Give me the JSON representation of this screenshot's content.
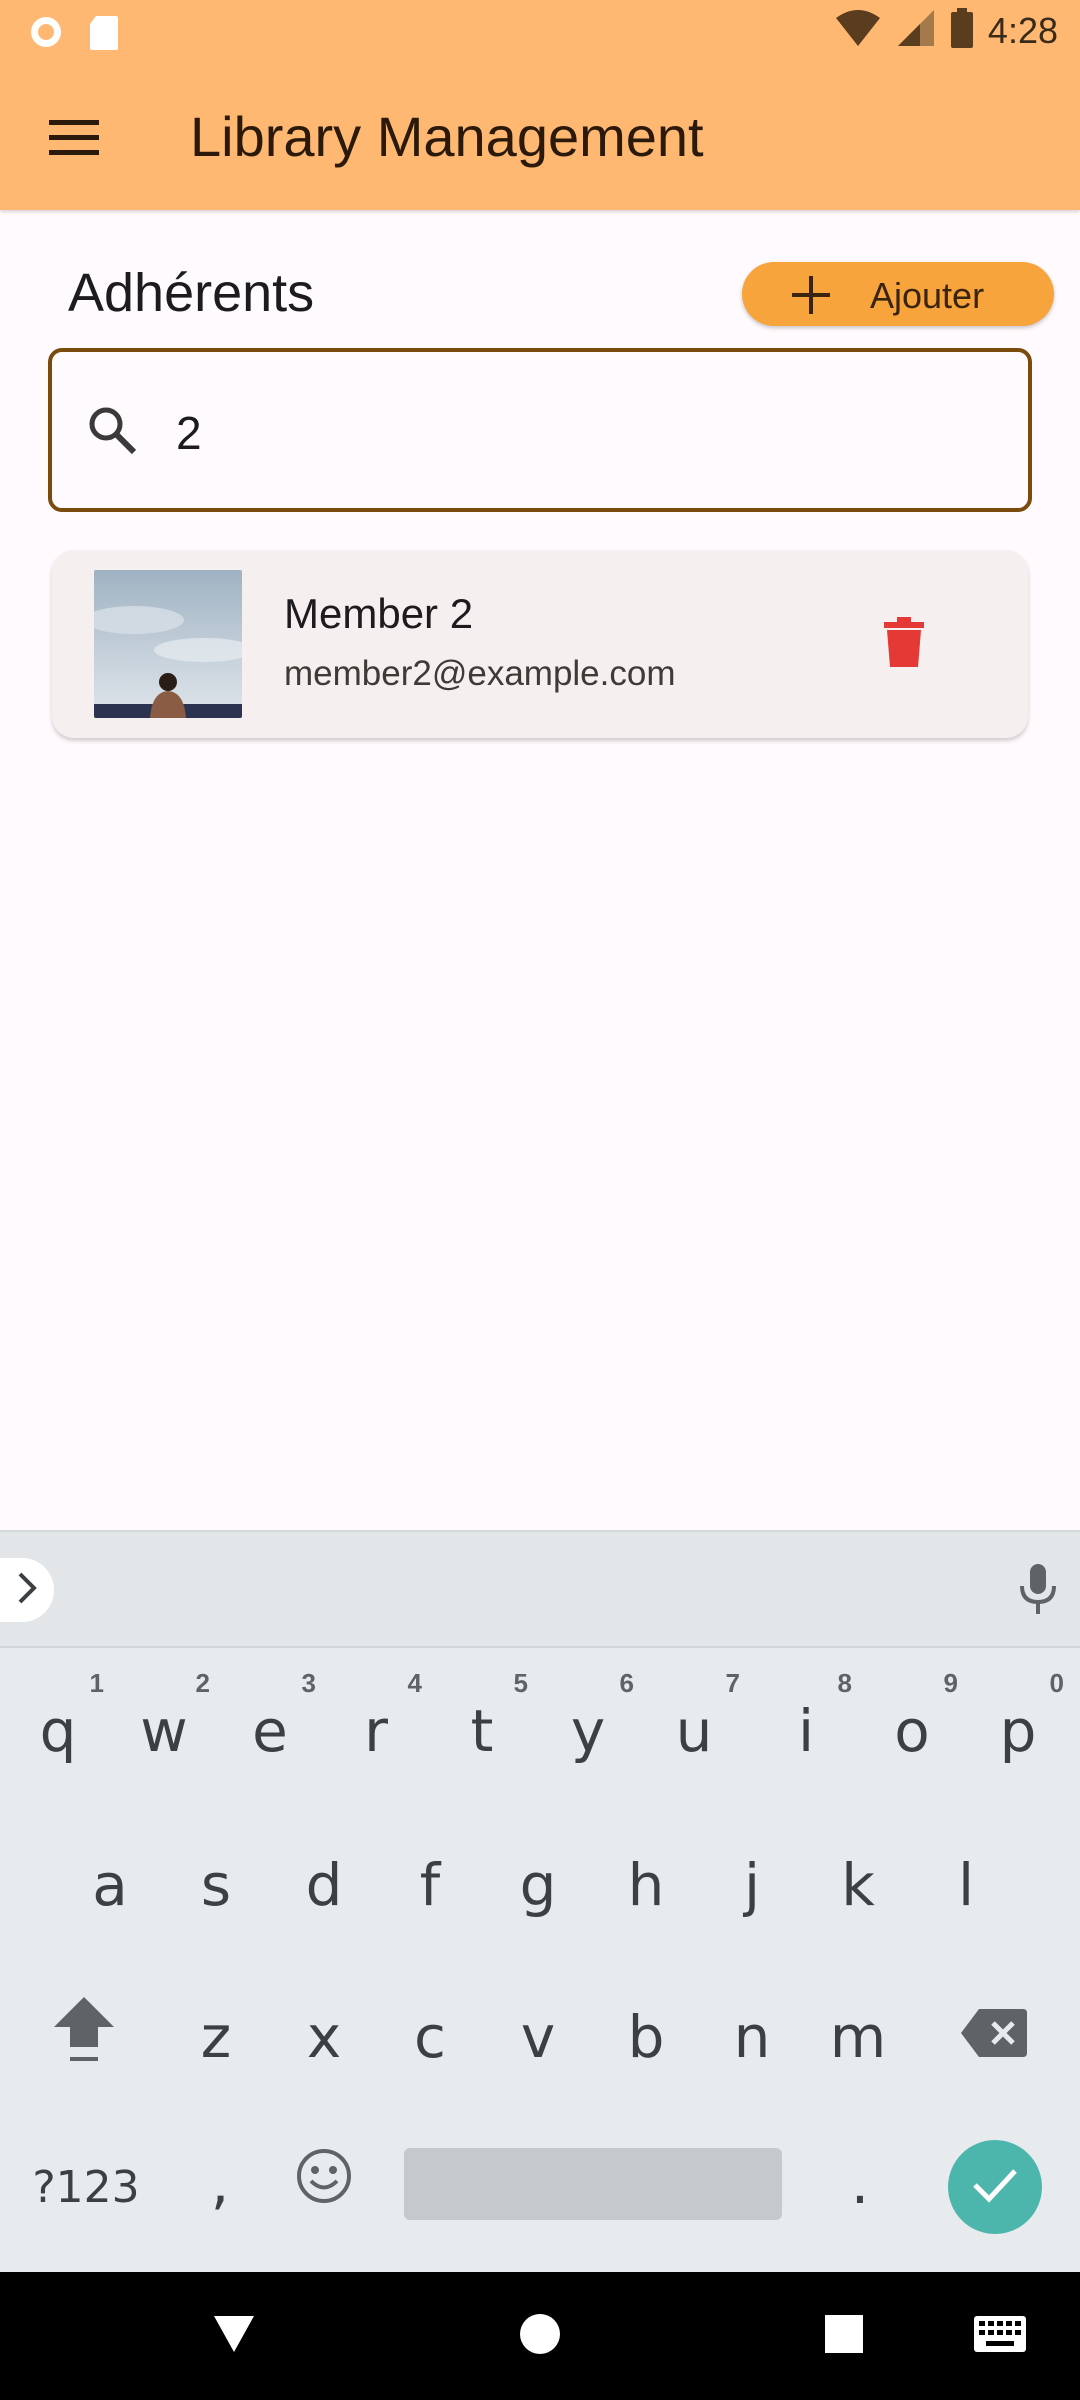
{
  "status_bar": {
    "time": "4:28",
    "icons": [
      "circle-notification-icon",
      "sd-card-icon",
      "wifi-icon",
      "signal-icon",
      "battery-icon"
    ]
  },
  "app_bar": {
    "title": "Library Management",
    "menu_icon": "menu-icon",
    "background": "#ffb871"
  },
  "members_section": {
    "title": "Adhérents",
    "add_button_label": "Ajouter",
    "add_button_color": "#f6a43b"
  },
  "search": {
    "value": "2",
    "icon": "search-icon",
    "border_color": "#7b4b0e"
  },
  "members": [
    {
      "name": "Member 2",
      "email": "member2@example.com",
      "avatar": "photo-avatar",
      "delete_icon": "trash-icon",
      "delete_color": "#e53935"
    }
  ],
  "keyboard": {
    "row1": [
      {
        "key": "q",
        "num": "1"
      },
      {
        "key": "w",
        "num": "2"
      },
      {
        "key": "e",
        "num": "3"
      },
      {
        "key": "r",
        "num": "4"
      },
      {
        "key": "t",
        "num": "5"
      },
      {
        "key": "y",
        "num": "6"
      },
      {
        "key": "u",
        "num": "7"
      },
      {
        "key": "i",
        "num": "8"
      },
      {
        "key": "o",
        "num": "9"
      },
      {
        "key": "p",
        "num": "0"
      }
    ],
    "row2": [
      "a",
      "s",
      "d",
      "f",
      "g",
      "h",
      "j",
      "k",
      "l"
    ],
    "row3": [
      "z",
      "x",
      "c",
      "v",
      "b",
      "n",
      "m"
    ],
    "symbols_label": "?123",
    "comma": ",",
    "period": ".",
    "done_color": "#4db6ac"
  },
  "nav_bar": {
    "items": [
      "back-icon",
      "home-icon",
      "recents-icon",
      "keyboard-switch-icon"
    ]
  }
}
